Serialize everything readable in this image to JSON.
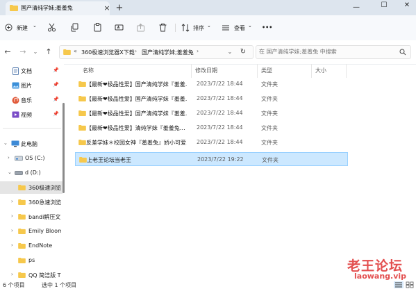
{
  "window": {
    "tab_title": "国产清纯学妹;羞羞兔",
    "new_tab_label": "+",
    "controls": {
      "minimize": "—",
      "maximize": "☐",
      "close": "✕"
    }
  },
  "toolbar": {
    "new_label": "新建",
    "sort_label": "排序",
    "view_label": "查看",
    "more_label": "•••",
    "dropdown_glyph": "⌄"
  },
  "address": {
    "overflow": "«",
    "crumbs": [
      "360极速浏览器X下载",
      "国产清纯学妹;羞羞兔"
    ],
    "separator": "›",
    "search_placeholder": "在 国产清纯学妹;羞羞兔 中搜索"
  },
  "nav": {
    "quick_access": [
      {
        "label": "文档",
        "icon": "documents-icon"
      },
      {
        "label": "图片",
        "icon": "pictures-icon"
      },
      {
        "label": "音乐",
        "icon": "music-icon"
      },
      {
        "label": "视频",
        "icon": "videos-icon"
      }
    ],
    "this_pc": "此电脑",
    "drive_c": "OS (C:)",
    "drive_d": "d (D:)",
    "folders": [
      "360极速浏览",
      "360急速浏览",
      "bandi解压文",
      "Emily Bloom",
      "EndNote",
      "ps",
      "QQ 简洁版 T"
    ]
  },
  "columns": {
    "name": "名称",
    "date": "修改日期",
    "type": "类型",
    "size": "大小"
  },
  "files": [
    {
      "name": "【最新❤极品性爱】国产清纯学妹『羞羞…",
      "date": "2023/7/22 18:44",
      "type": "文件夹"
    },
    {
      "name": "【最新❤极品性爱】国产清纯学妹『羞羞…",
      "date": "2023/7/22 18:44",
      "type": "文件夹"
    },
    {
      "name": "【最新❤极品性爱】国产清纯学妹『羞羞…",
      "date": "2023/7/22 18:44",
      "type": "文件夹"
    },
    {
      "name": "【最新❤极品性爱】清纯学妹『羞羞兔…",
      "date": "2023/7/22 18:44",
      "type": "文件夹"
    },
    {
      "name": "反差学妹＊校园女神『羞羞兔』娇小可爱…",
      "date": "2023/7/22 18:44",
      "type": "文件夹"
    },
    {
      "name": "上老王论坛当老王",
      "date": "2023/7/22 19:22",
      "type": "文件夹"
    }
  ],
  "status": {
    "item_count": "6 个项目",
    "selected": "选中 1 个项目"
  },
  "watermark": {
    "line1": "老王论坛",
    "line2": "laowang.vip"
  },
  "colors": {
    "folder": "#f6c84c",
    "selection": "#cce8ff",
    "watermark": "#e03c3c",
    "accent": "#0067c0"
  }
}
